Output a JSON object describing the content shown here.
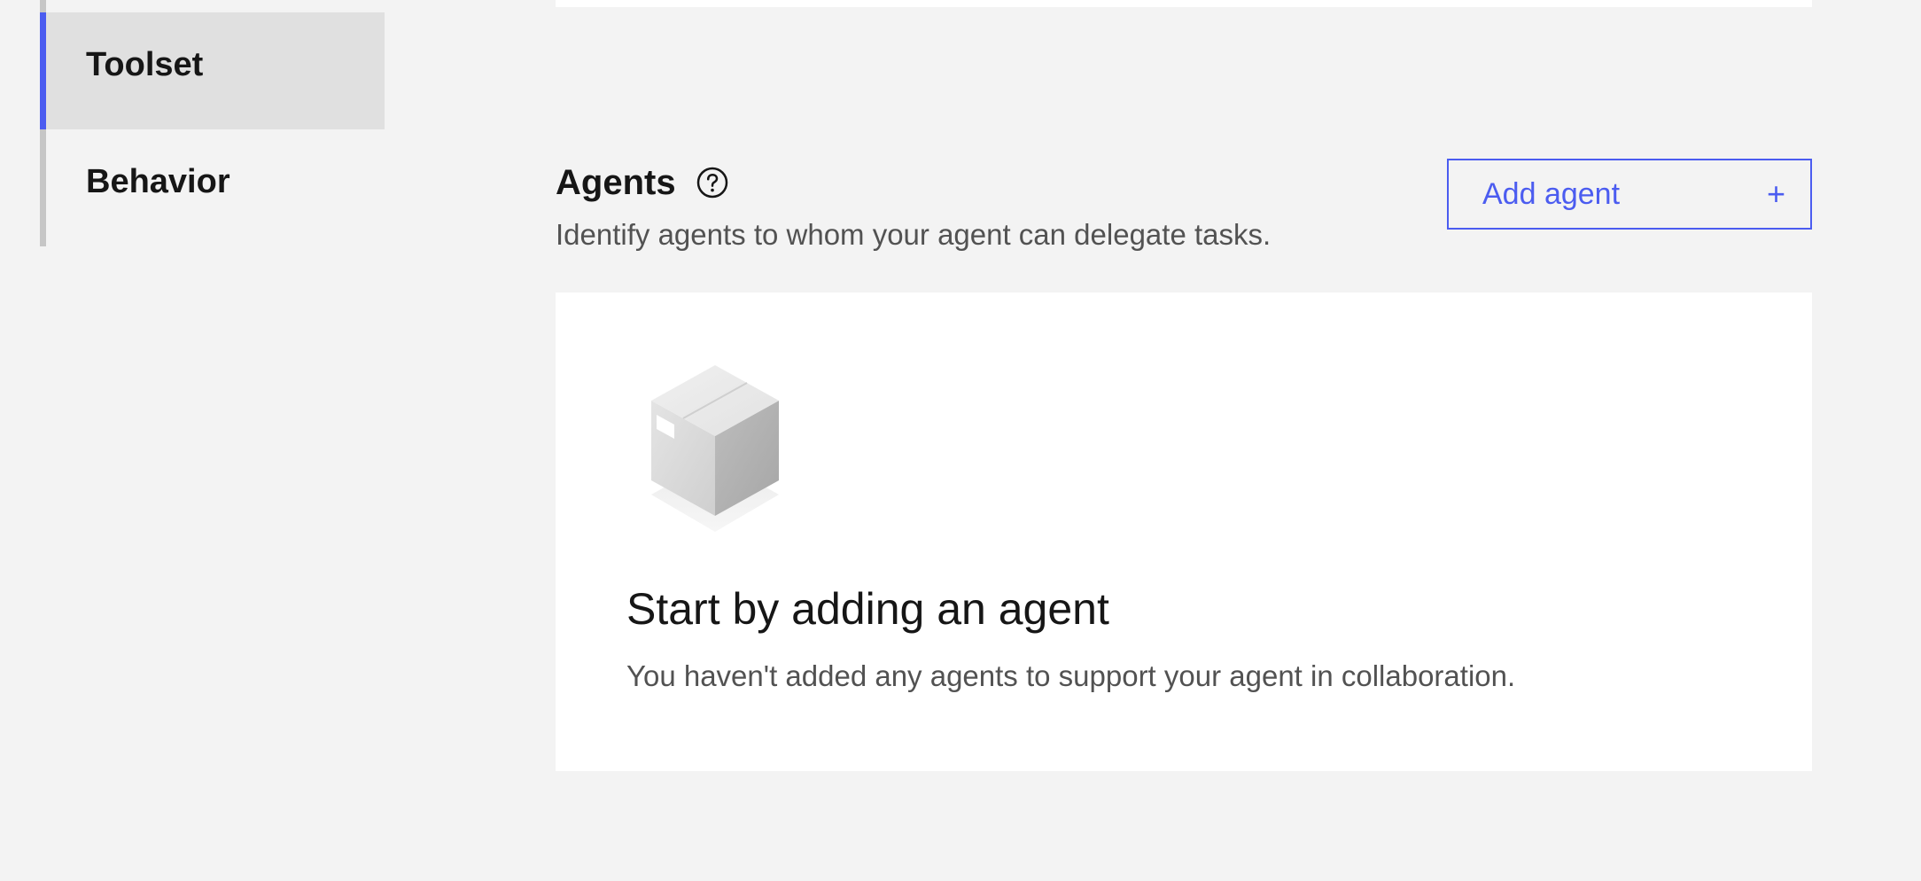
{
  "sidebar": {
    "items": [
      {
        "label": "Toolset",
        "active": true
      },
      {
        "label": "Behavior",
        "active": false
      }
    ]
  },
  "agents_section": {
    "title": "Agents",
    "help_icon": "question-circle-icon",
    "description": "Identify agents to whom your agent can delegate tasks.",
    "add_button": {
      "label": "Add agent",
      "icon": "plus-icon",
      "icon_glyph": "+"
    }
  },
  "empty_state": {
    "illustration": "box-icon",
    "title": "Start by adding an agent",
    "description": "You haven't added any agents to support your agent in collaboration."
  },
  "colors": {
    "accent": "#4b5cf0",
    "background": "#f3f3f3",
    "card": "#ffffff",
    "active_item_bg": "#e0e0e0",
    "text_primary": "#161616",
    "text_secondary": "#525252"
  }
}
